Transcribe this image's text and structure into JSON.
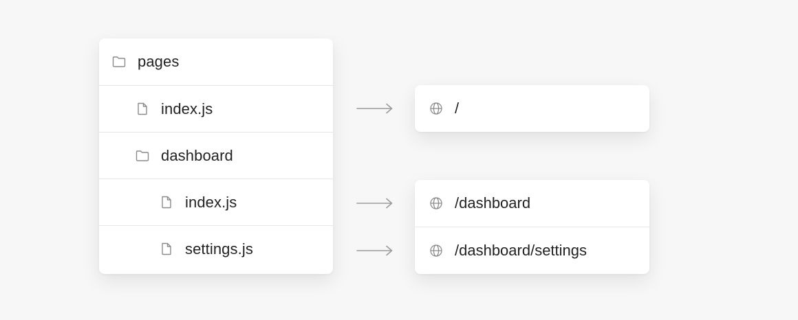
{
  "tree": {
    "items": [
      {
        "label": "pages",
        "icon": "folder-icon",
        "depth": 0
      },
      {
        "label": "index.js",
        "icon": "file-icon",
        "depth": 1
      },
      {
        "label": "dashboard",
        "icon": "folder-icon",
        "depth": 1
      },
      {
        "label": "index.js",
        "icon": "file-icon",
        "depth": 2
      },
      {
        "label": "settings.js",
        "icon": "file-icon",
        "depth": 2
      }
    ]
  },
  "routes": {
    "group1": [
      {
        "label": "/",
        "icon": "globe-icon"
      }
    ],
    "group2": [
      {
        "label": "/dashboard",
        "icon": "globe-icon"
      },
      {
        "label": "/dashboard/settings",
        "icon": "globe-icon"
      }
    ]
  },
  "colors": {
    "background": "#f7f7f7",
    "card": "#ffffff",
    "divider": "#e6e6e6",
    "text": "#222222",
    "icon": "#8a8a8a",
    "arrow": "#9a9a9a"
  }
}
